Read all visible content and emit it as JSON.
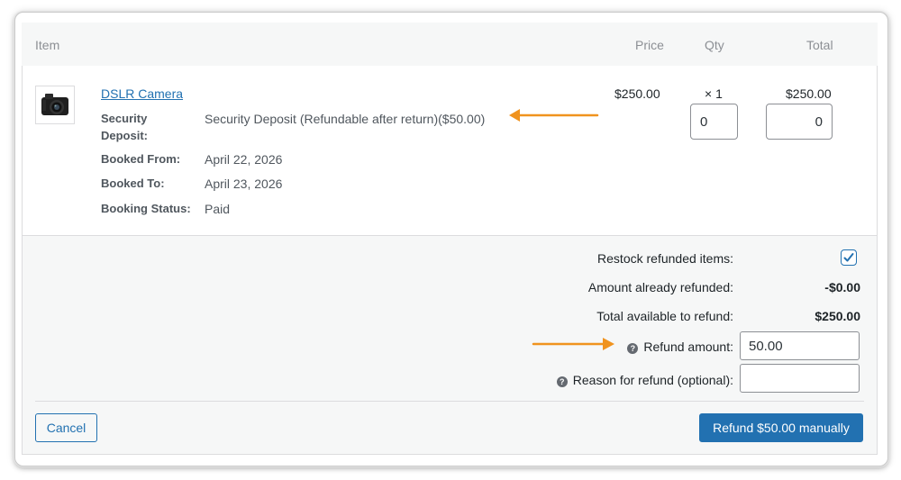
{
  "table": {
    "headers": {
      "item": "Item",
      "price": "Price",
      "qty": "Qty",
      "total": "Total"
    }
  },
  "item": {
    "name": "DSLR Camera",
    "thumbnail_icon": "camera-icon",
    "meta": [
      {
        "label": "Security Deposit:",
        "value": "Security Deposit (Refundable after return)($50.00)"
      },
      {
        "label": "Booked From:",
        "value": "April 22, 2026"
      },
      {
        "label": "Booked To:",
        "value": "April 23, 2026"
      },
      {
        "label": "Booking Status:",
        "value": "Paid"
      }
    ],
    "price": "$250.00",
    "qty": "× 1",
    "total": "$250.00",
    "refund_qty_value": "0",
    "refund_total_value": "0"
  },
  "refund": {
    "restock_label": "Restock refunded items:",
    "restock_checked": true,
    "already_refunded_label": "Amount already refunded:",
    "already_refunded_value": "-$0.00",
    "available_label": "Total available to refund:",
    "available_value": "$250.00",
    "amount_label": "Refund amount:",
    "amount_value": "50.00",
    "reason_label": "Reason for refund (optional):",
    "reason_value": "",
    "help_icon": "help-icon"
  },
  "actions": {
    "cancel_label": "Cancel",
    "refund_label": "Refund $50.00 manually"
  },
  "colors": {
    "accent": "#2271b1",
    "annotation_arrow": "#f0931e"
  }
}
